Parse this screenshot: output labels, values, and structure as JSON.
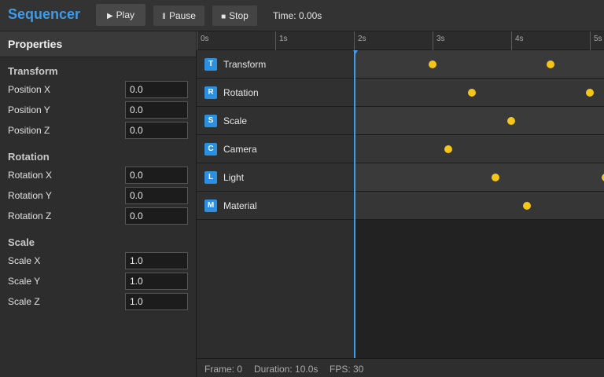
{
  "app": {
    "title": "Sequencer"
  },
  "toolbar": {
    "play_label": "Play",
    "pause_label": "Pause",
    "stop_label": "Stop",
    "time_label": "Time: 0.00s"
  },
  "properties": {
    "header": "Properties",
    "sections": [
      {
        "title": "Transform",
        "fields": [
          {
            "label": "Position X",
            "value": "0.0"
          },
          {
            "label": "Position Y",
            "value": "0.0"
          },
          {
            "label": "Position Z",
            "value": "0.0"
          }
        ]
      },
      {
        "title": "Rotation",
        "fields": [
          {
            "label": "Rotation X",
            "value": "0.0"
          },
          {
            "label": "Rotation Y",
            "value": "0.0"
          },
          {
            "label": "Rotation Z",
            "value": "0.0"
          }
        ]
      },
      {
        "title": "Scale",
        "fields": [
          {
            "label": "Scale X",
            "value": "1.0"
          },
          {
            "label": "Scale Y",
            "value": "1.0"
          },
          {
            "label": "Scale Z",
            "value": "1.0"
          }
        ]
      }
    ]
  },
  "timeline": {
    "ruler": [
      "0s",
      "1s",
      "2s",
      "3s",
      "4s",
      "5s"
    ],
    "playhead_time_s": 2.0,
    "tracks": [
      {
        "badge": "T",
        "name": "Transform",
        "keyframes_s": [
          3.0,
          4.5
        ]
      },
      {
        "badge": "R",
        "name": "Rotation",
        "keyframes_s": [
          3.5,
          5.0
        ]
      },
      {
        "badge": "S",
        "name": "Scale",
        "keyframes_s": [
          4.0
        ]
      },
      {
        "badge": "C",
        "name": "Camera",
        "keyframes_s": [
          3.2
        ]
      },
      {
        "badge": "L",
        "name": "Light",
        "keyframes_s": [
          3.8,
          5.2
        ]
      },
      {
        "badge": "M",
        "name": "Material",
        "keyframes_s": [
          4.2
        ]
      }
    ]
  },
  "status": {
    "frame": "Frame: 0",
    "duration": "Duration: 10.0s",
    "fps": "FPS: 30"
  },
  "colors": {
    "accent": "#3d9be9",
    "keyframe": "#f5c518",
    "badge": "#2d8fe0"
  }
}
